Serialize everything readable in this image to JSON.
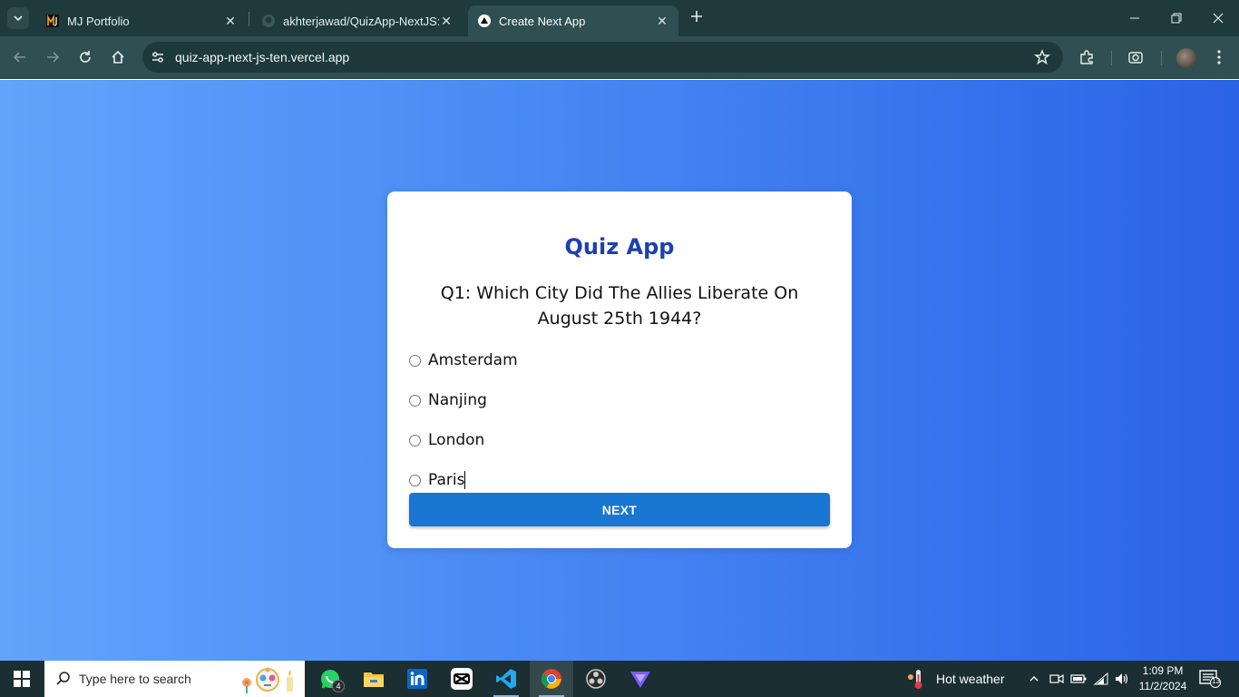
{
  "browser": {
    "tabs": [
      {
        "title": "MJ Portfolio",
        "favicon": "mj-logo-icon"
      },
      {
        "title": "akhterjawad/QuizApp-NextJS: B",
        "favicon": "github-icon"
      },
      {
        "title": "Create Next App",
        "favicon": "nextjs-icon",
        "active": true
      }
    ],
    "url": "quiz-app-next-js-ten.vercel.app"
  },
  "quiz": {
    "title": "Quiz App",
    "question": "Q1: Which City Did The Allies Liberate On August 25th 1944?",
    "options": [
      "Amsterdam",
      "Nanjing",
      "London",
      "Paris"
    ],
    "next_label": "NEXT"
  },
  "taskbar": {
    "search_placeholder": "Type here to search",
    "whatsapp_badge": "4",
    "weather": "Hot weather",
    "time": "1:09 PM",
    "date": "11/2/2024",
    "notification_count": "13"
  },
  "colors": {
    "page_gradient_start": "#62a4fb",
    "page_gradient_end": "#2a63e6",
    "title_color": "#1e40af",
    "button_color": "#1976d2"
  }
}
